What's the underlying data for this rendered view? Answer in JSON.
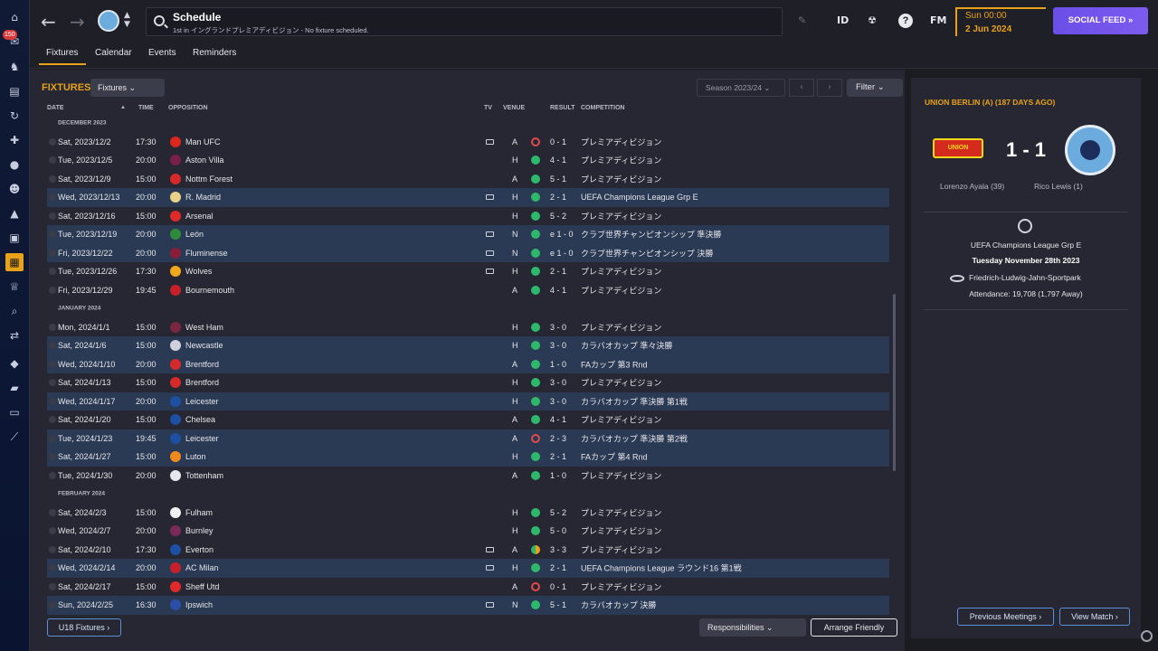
{
  "sidebar": {
    "badge": "150",
    "icons": [
      "home-icon",
      "inbox-icon",
      "squad-icon",
      "tactics-icon",
      "training-icon",
      "medical-icon",
      "data-hub-icon",
      "staff-icon",
      "club-vision-icon",
      "finances-icon",
      "schedule-icon",
      "competitions-icon",
      "scouting-icon",
      "transfers-icon",
      "club-info-icon",
      "dev-centre-icon",
      "report-icon",
      "editor-icon"
    ]
  },
  "topbar": {
    "back": "←",
    "forward": "→",
    "search_title": "Schedule",
    "search_subtitle": "1st in イングランドプレミアディビジョン - No fixture scheduled.",
    "pen_icon": "✎",
    "id_label": "ID",
    "help": "?",
    "fm_label": "FM",
    "date_line1": "Sun 00:00",
    "date_line2": "2 Jun 2024",
    "social_feed": "SOCIAL FEED  »"
  },
  "tabs": [
    "Fixtures",
    "Calendar",
    "Events",
    "Reminders"
  ],
  "fixtures": {
    "heading": "FIXTURES",
    "view_dropdown": "Fixtures ⌄",
    "season": "Season 2023/24   ⌄",
    "prev": "‹",
    "next": "›",
    "filter": "Filter ⌄",
    "columns": {
      "date": "DATE",
      "sort": "▲",
      "time": "TIME",
      "opposition": "OPPOSITION",
      "tv": "TV",
      "venue": "VENUE",
      "result": "RESULT",
      "competition": "COMPETITION"
    },
    "rows": [
      {
        "section": "DECEMBER 2023"
      },
      {
        "date": "Sat, 2023/12/2",
        "time": "17:30",
        "opp": "Man UFC",
        "crest": "#da291c",
        "tv": true,
        "venue": "A",
        "res": "loss",
        "score": "0 - 1",
        "comp": "プレミアディビジョン",
        "hl": false
      },
      {
        "date": "Tue, 2023/12/5",
        "time": "20:00",
        "opp": "Aston Villa",
        "crest": "#7a1f4a",
        "tv": false,
        "venue": "H",
        "res": "win",
        "score": "4 - 1",
        "comp": "プレミアディビジョン",
        "hl": false
      },
      {
        "date": "Sat, 2023/12/9",
        "time": "15:00",
        "opp": "Nottm Forest",
        "crest": "#d62a2a",
        "tv": false,
        "venue": "A",
        "res": "win",
        "score": "5 - 1",
        "comp": "プレミアディビジョン",
        "hl": false
      },
      {
        "date": "Wed, 2023/12/13",
        "time": "20:00",
        "opp": "R. Madrid",
        "crest": "#e8d28a",
        "tv": true,
        "venue": "H",
        "res": "win",
        "score": "2 - 1",
        "comp": "UEFA Champions League Grp E",
        "hl": true
      },
      {
        "date": "Sat, 2023/12/16",
        "time": "15:00",
        "opp": "Arsenal",
        "crest": "#e02a2a",
        "tv": false,
        "venue": "H",
        "res": "win",
        "score": "5 - 2",
        "comp": "プレミアディビジョン",
        "hl": false
      },
      {
        "date": "Tue, 2023/12/19",
        "time": "20:00",
        "opp": "León",
        "crest": "#2f8a3a",
        "tv": true,
        "venue": "N",
        "res": "win",
        "score": "e 1 - 0",
        "comp": "クラブ世界チャンピオンシップ 準決勝",
        "hl": true
      },
      {
        "date": "Fri, 2023/12/22",
        "time": "20:00",
        "opp": "Fluminense",
        "crest": "#8a1e3a",
        "tv": true,
        "venue": "N",
        "res": "win",
        "score": "e 1 - 0",
        "comp": "クラブ世界チャンピオンシップ 決勝",
        "hl": true
      },
      {
        "date": "Tue, 2023/12/26",
        "time": "17:30",
        "opp": "Wolves",
        "crest": "#f2a81c",
        "tv": true,
        "venue": "H",
        "res": "win",
        "score": "2 - 1",
        "comp": "プレミアディビジョン",
        "hl": false
      },
      {
        "date": "Fri, 2023/12/29",
        "time": "19:45",
        "opp": "Bournemouth",
        "crest": "#c8202a",
        "tv": false,
        "venue": "A",
        "res": "win",
        "score": "4 - 1",
        "comp": "プレミアディビジョン",
        "hl": false
      },
      {
        "section": "JANUARY 2024"
      },
      {
        "date": "Mon, 2024/1/1",
        "time": "15:00",
        "opp": "West Ham",
        "crest": "#7a2640",
        "tv": false,
        "venue": "H",
        "res": "win",
        "score": "3 - 0",
        "comp": "プレミアディビジョン",
        "hl": false
      },
      {
        "date": "Sat, 2024/1/6",
        "time": "15:00",
        "opp": "Newcastle",
        "crest": "#cfd2dc",
        "tv": false,
        "venue": "H",
        "res": "win",
        "score": "3 - 0",
        "comp": "カラバオカップ 準々決勝",
        "hl": true
      },
      {
        "date": "Wed, 2024/1/10",
        "time": "20:00",
        "opp": "Brentford",
        "crest": "#d62a2a",
        "tv": false,
        "venue": "A",
        "res": "win",
        "score": "1 - 0",
        "comp": "FAカップ 第3 Rnd",
        "hl": true
      },
      {
        "date": "Sat, 2024/1/13",
        "time": "15:00",
        "opp": "Brentford",
        "crest": "#d62a2a",
        "tv": false,
        "venue": "H",
        "res": "win",
        "score": "3 - 0",
        "comp": "プレミアディビジョン",
        "hl": false
      },
      {
        "date": "Wed, 2024/1/17",
        "time": "20:00",
        "opp": "Leicester",
        "crest": "#1d4fa3",
        "tv": false,
        "venue": "H",
        "res": "win",
        "score": "3 - 0",
        "comp": "カラバオカップ 準決勝 第1戦",
        "hl": true
      },
      {
        "date": "Sat, 2024/1/20",
        "time": "15:00",
        "opp": "Chelsea",
        "crest": "#1d4fa3",
        "tv": false,
        "venue": "A",
        "res": "win",
        "score": "4 - 1",
        "comp": "プレミアディビジョン",
        "hl": false
      },
      {
        "date": "Tue, 2024/1/23",
        "time": "19:45",
        "opp": "Leicester",
        "crest": "#1d4fa3",
        "tv": false,
        "venue": "A",
        "res": "loss",
        "score": "2 - 3",
        "comp": "カラバオカップ 準決勝 第2戦",
        "hl": true
      },
      {
        "date": "Sat, 2024/1/27",
        "time": "15:00",
        "opp": "Luton",
        "crest": "#f08a1c",
        "tv": false,
        "venue": "H",
        "res": "win",
        "score": "2 - 1",
        "comp": "FAカップ 第4 Rnd",
        "hl": true
      },
      {
        "date": "Tue, 2024/1/30",
        "time": "20:00",
        "opp": "Tottenham",
        "crest": "#e6e8ef",
        "tv": false,
        "venue": "A",
        "res": "win",
        "score": "1 - 0",
        "comp": "プレミアディビジョン",
        "hl": false
      },
      {
        "section": "FEBRUARY 2024"
      },
      {
        "date": "Sat, 2024/2/3",
        "time": "15:00",
        "opp": "Fulham",
        "crest": "#f2f2f2",
        "tv": false,
        "venue": "H",
        "res": "win",
        "score": "5 - 2",
        "comp": "プレミアディビジョン",
        "hl": false
      },
      {
        "date": "Wed, 2024/2/7",
        "time": "20:00",
        "opp": "Burnley",
        "crest": "#7a2a5a",
        "tv": false,
        "venue": "H",
        "res": "win",
        "score": "5 - 0",
        "comp": "プレミアディビジョン",
        "hl": false
      },
      {
        "date": "Sat, 2024/2/10",
        "time": "17:30",
        "opp": "Everton",
        "crest": "#1d4fa3",
        "tv": true,
        "venue": "A",
        "res": "draw",
        "score": "3 - 3",
        "comp": "プレミアディビジョン",
        "hl": false
      },
      {
        "date": "Wed, 2024/2/14",
        "time": "20:00",
        "opp": "AC Milan",
        "crest": "#c8202a",
        "tv": true,
        "venue": "H",
        "res": "win",
        "score": "2 - 1",
        "comp": "UEFA Champions League ラウンド16 第1戦",
        "hl": true
      },
      {
        "date": "Sat, 2024/2/17",
        "time": "15:00",
        "opp": "Sheff Utd",
        "crest": "#e02a2a",
        "tv": false,
        "venue": "A",
        "res": "loss",
        "score": "0 - 1",
        "comp": "プレミアディビジョン",
        "hl": false
      },
      {
        "date": "Sun, 2024/2/25",
        "time": "16:30",
        "opp": "Ipswich",
        "crest": "#2a4fa8",
        "tv": true,
        "venue": "N",
        "res": "win",
        "score": "5 - 1",
        "comp": "カラバオカップ 決勝",
        "hl": true
      }
    ],
    "u18_button": "U18 Fixtures ›",
    "responsibilities": "Responsibilities ⌄",
    "arrange_friendly": "Arrange Friendly"
  },
  "match_panel": {
    "title": "UNION BERLIN (A) (187 DAYS AGO)",
    "home_badge": "UNION",
    "score": "1 - 1",
    "home_scorer": "Lorenzo Ayala (39)",
    "away_scorer": "Rico Lewis (1)",
    "competition": "UEFA Champions League Grp E",
    "date": "Tuesday November 28th 2023",
    "venue": "Friedrich-Ludwig-Jahn-Sportpark",
    "attendance": "Attendance: 19,708 (1,797 Away)",
    "previous_meetings": "Previous Meetings ›",
    "view_match": "View Match ›"
  },
  "colors": {
    "accent": "#e8a21a",
    "win": "#2eb86b",
    "loss": "#e24a4a",
    "highlight_row": "#2b3a54",
    "social": "#6a4fe6"
  }
}
